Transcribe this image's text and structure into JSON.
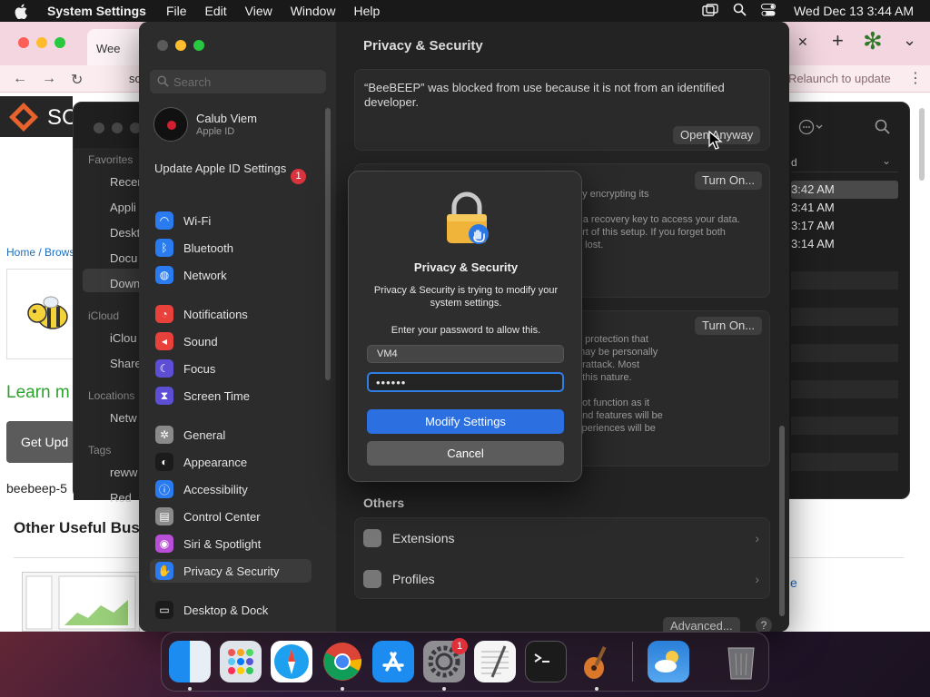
{
  "menubar": {
    "app_name": "System Settings",
    "menus": [
      "File",
      "Edit",
      "View",
      "Window",
      "Help"
    ],
    "clock": "Wed Dec 13  3:44 AM"
  },
  "browser": {
    "tab_title": "Wee",
    "address": "sc",
    "relaunch": "Relaunch to update",
    "site_name": "SC",
    "breadcrumb": "Home / Brows",
    "learn_more": "Learn m",
    "get_update": "Get Upd",
    "file_name": "beebeep-5",
    "other_useful": "Other Useful Bus",
    "right_link": "e"
  },
  "finder": {
    "favorites_label": "Favorites",
    "favorites": [
      "Recen",
      "Appli",
      "Deskt",
      "Docu",
      "Down"
    ],
    "icloud_label": "iCloud",
    "icloud": [
      "iClou",
      "Share"
    ],
    "locations_label": "Locations",
    "locations": [
      "Netw"
    ],
    "tags_label": "Tags",
    "tags": [
      "reww",
      "Red"
    ],
    "column_header": "d",
    "times": [
      "3:42 AM",
      "3:41 AM",
      "3:17 AM",
      "3:14 AM"
    ]
  },
  "settings": {
    "search_placeholder": "Search",
    "account_name": "Calub Viem",
    "account_sub": "Apple ID",
    "update_apple_id": "Update Apple ID Settings",
    "update_badge": "1",
    "groups": [
      [
        {
          "label": "Wi-Fi",
          "icon": "wifi-icon",
          "color": "#2b7bf0"
        },
        {
          "label": "Bluetooth",
          "icon": "bluetooth-icon",
          "color": "#2b7bf0"
        },
        {
          "label": "Network",
          "icon": "globe-icon",
          "color": "#2b7bf0"
        }
      ],
      [
        {
          "label": "Notifications",
          "icon": "bell-icon",
          "color": "#e8413c"
        },
        {
          "label": "Sound",
          "icon": "speaker-icon",
          "color": "#e8413c"
        },
        {
          "label": "Focus",
          "icon": "moon-icon",
          "color": "#5c4fd6"
        },
        {
          "label": "Screen Time",
          "icon": "hourglass-icon",
          "color": "#5c4fd6"
        }
      ],
      [
        {
          "label": "General",
          "icon": "gear-icon",
          "color": "#8a8a8a"
        },
        {
          "label": "Appearance",
          "icon": "appearance-icon",
          "color": "#1b1b1b"
        },
        {
          "label": "Accessibility",
          "icon": "accessibility-icon",
          "color": "#2b7bf0"
        },
        {
          "label": "Control Center",
          "icon": "control-center-icon",
          "color": "#8a8a8a"
        },
        {
          "label": "Siri & Spotlight",
          "icon": "siri-icon",
          "color": "#b84fd6"
        },
        {
          "label": "Privacy & Security",
          "icon": "hand-icon",
          "color": "#2b7bf0",
          "selected": true
        }
      ],
      [
        {
          "label": "Desktop & Dock",
          "icon": "dock-icon",
          "color": "#1b1b1b"
        }
      ]
    ],
    "content_title": "Privacy & Security",
    "blocked_text": "“BeeBEEP” was blocked from use because it is not from an identified developer.",
    "open_anyway": "Open Anyway",
    "turn_on_1": "Turn On...",
    "filevault_text": "by encrypting its\n\nr a recovery key to access your data.\nart of this setup. If you forget both\ne lost.",
    "turn_on_2": "Turn On...",
    "lockdown_text": "d protection that\nmay be personally\nerattack. Most\nf this nature.\n\nnot function as it\nand features will be\nxperiences will be",
    "others_label": "Others",
    "others": [
      "Extensions",
      "Profiles"
    ],
    "advanced": "Advanced...",
    "help": "?"
  },
  "dialog": {
    "title": "Privacy & Security",
    "message": "Privacy & Security is trying to modify your system settings.",
    "prompt": "Enter your password to allow this.",
    "username": "VM4",
    "password": "••••••",
    "primary_button": "Modify Settings",
    "cancel_button": "Cancel"
  },
  "dock": {
    "apps": [
      "Finder",
      "Launchpad",
      "Safari",
      "Chrome",
      "App Store",
      "System Settings",
      "TextEdit",
      "Terminal",
      "GarageBand",
      "Weather",
      "Trash"
    ],
    "settings_badge": "1"
  },
  "colors": {
    "accent": "#2b6fe0",
    "traffic_red": "#ff5f57",
    "traffic_yellow": "#febc2e",
    "traffic_green": "#28c840"
  }
}
